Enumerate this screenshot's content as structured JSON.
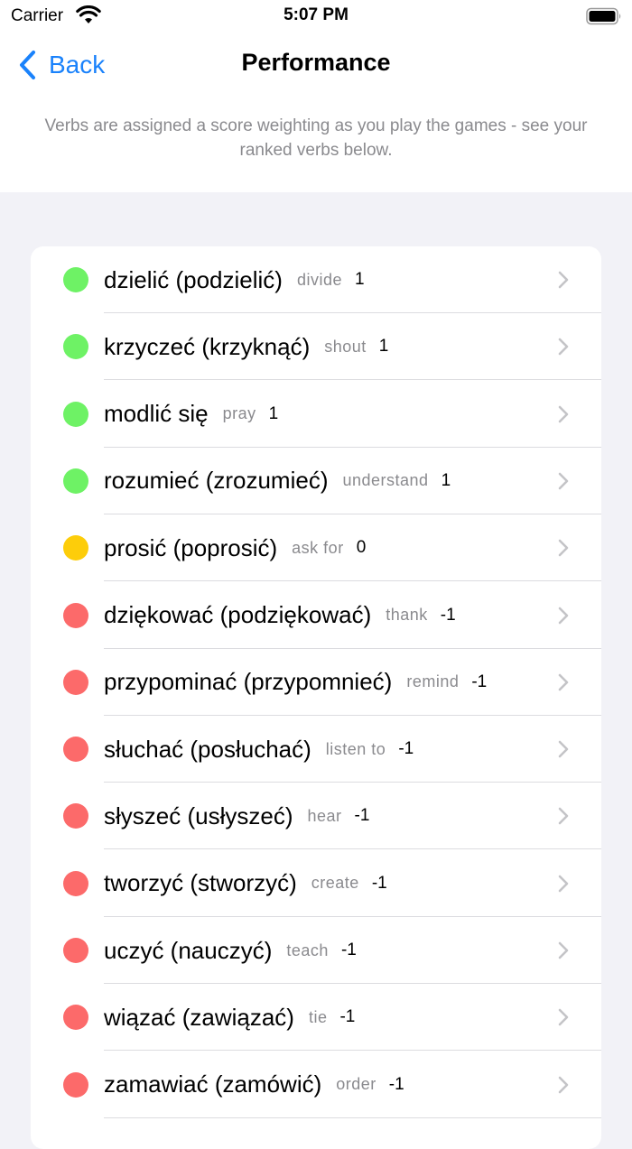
{
  "status_bar": {
    "carrier": "Carrier",
    "time": "5:07 PM",
    "wifi_icon": "wifi-icon",
    "battery_icon": "battery-icon"
  },
  "nav": {
    "back_label": "Back",
    "title": "Performance"
  },
  "description": "Verbs are assigned a score weighting as you play the games - see your ranked verbs below.",
  "colors": {
    "accent": "#1a82fb",
    "positive": "#6ef265",
    "neutral": "#fdcd0a",
    "negative": "#fc6a6a"
  },
  "verbs": [
    {
      "verb": "dzielić (podzielić)",
      "meaning": "divide",
      "score": "1",
      "status": "positive"
    },
    {
      "verb": "krzyczeć (krzyknąć)",
      "meaning": "shout",
      "score": "1",
      "status": "positive"
    },
    {
      "verb": "modlić się",
      "meaning": "pray",
      "score": "1",
      "status": "positive"
    },
    {
      "verb": "rozumieć (zrozumieć)",
      "meaning": "understand",
      "score": "1",
      "status": "positive"
    },
    {
      "verb": "prosić (poprosić)",
      "meaning": "ask for",
      "score": "0",
      "status": "neutral"
    },
    {
      "verb": "dziękować (podziękować)",
      "meaning": "thank",
      "score": "-1",
      "status": "negative"
    },
    {
      "verb": "przypominać (przypomnieć)",
      "meaning": "remind",
      "score": "-1",
      "status": "negative"
    },
    {
      "verb": "słuchać (posłuchać)",
      "meaning": "listen to",
      "score": "-1",
      "status": "negative"
    },
    {
      "verb": "słyszeć (usłyszeć)",
      "meaning": "hear",
      "score": "-1",
      "status": "negative"
    },
    {
      "verb": "tworzyć (stworzyć)",
      "meaning": "create",
      "score": "-1",
      "status": "negative"
    },
    {
      "verb": "uczyć (nauczyć)",
      "meaning": "teach",
      "score": "-1",
      "status": "negative"
    },
    {
      "verb": "wiązać (zawiązać)",
      "meaning": "tie",
      "score": "-1",
      "status": "negative"
    },
    {
      "verb": "zamawiać (zamówić)",
      "meaning": "order",
      "score": "-1",
      "status": "negative"
    }
  ]
}
